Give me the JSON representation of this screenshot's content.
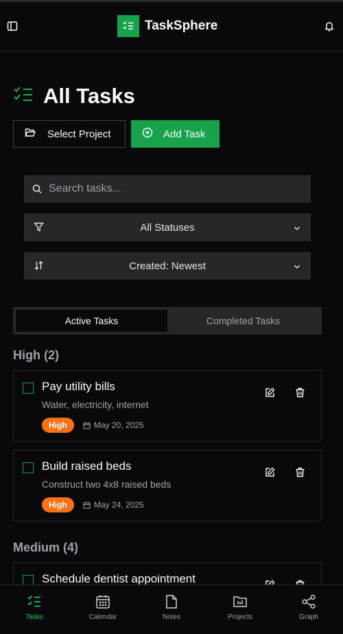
{
  "app": {
    "name": "TaskSphere"
  },
  "page": {
    "title": "All Tasks"
  },
  "actions": {
    "select_project": "Select Project",
    "add_task": "Add Task"
  },
  "filters": {
    "search_placeholder": "Search tasks...",
    "status_value": "All Statuses",
    "sort_value": "Created: Newest"
  },
  "tabs": [
    {
      "label": "Active Tasks",
      "active": true
    },
    {
      "label": "Completed Tasks",
      "active": false
    }
  ],
  "groups": [
    {
      "title": "High (2)",
      "tasks": [
        {
          "title": "Pay utility bills",
          "description": "Water, electricity, internet",
          "priority": "High",
          "due": "May 20, 2025"
        },
        {
          "title": "Build raised beds",
          "description": "Construct two 4x8 raised beds",
          "priority": "High",
          "due": "May 24, 2025"
        }
      ]
    },
    {
      "title": "Medium (4)",
      "tasks": [
        {
          "title": "Schedule dentist appointment"
        }
      ]
    }
  ],
  "nav": [
    {
      "label": "Tasks",
      "icon": "tasks-icon",
      "active": true
    },
    {
      "label": "Calendar",
      "icon": "calendar-icon",
      "active": false
    },
    {
      "label": "Notes",
      "icon": "notes-icon",
      "active": false
    },
    {
      "label": "Projects",
      "icon": "projects-icon",
      "active": false
    },
    {
      "label": "Graph",
      "icon": "graph-icon",
      "active": false
    }
  ],
  "colors": {
    "accent": "#16a34a",
    "priority_high": "#f97316",
    "background": "#09090b"
  }
}
